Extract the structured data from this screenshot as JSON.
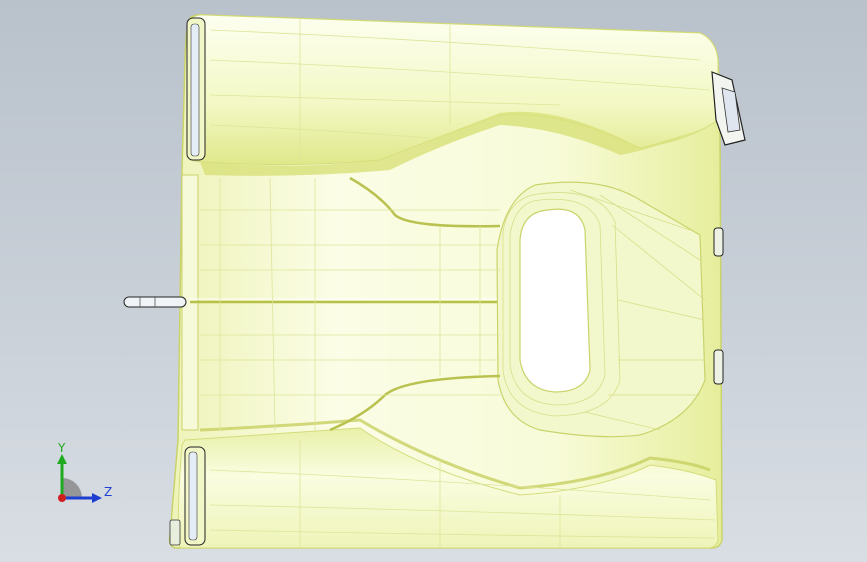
{
  "viewport": {
    "background_top": "#b9c1cb",
    "background_bottom": "#d9dee4"
  },
  "model": {
    "body_color": "#f6fad4",
    "edge_color": "#d8e07a",
    "outline_color": "#1a1a1a",
    "icon": "cad-part-top-view"
  },
  "triad": {
    "y_label": "Y",
    "z_label": "Z",
    "y_color": "#1faa1f",
    "z_color": "#1f3fd0",
    "x_color": "#d01f1f"
  }
}
